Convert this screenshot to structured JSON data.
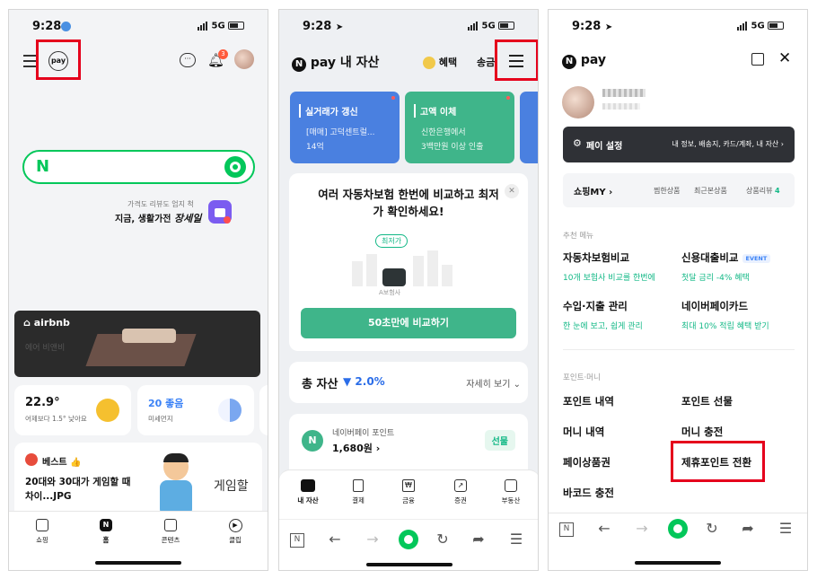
{
  "phone1": {
    "status": {
      "time": "9:28",
      "network": "5G"
    },
    "pay_logo": "pay",
    "notification_count": "3",
    "search_logo": "N",
    "promo": {
      "line1": "가격도 리뷰도 엄지 척",
      "line2": "지금, 생활가전",
      "brand": "장세일"
    },
    "banner": {
      "brand": "airbnb",
      "faded_text": "에어 비앤비"
    },
    "weather": {
      "temp": "22.9°",
      "desc": "어제보다 1.5° 낮아요"
    },
    "dust": {
      "status": "20 좋음",
      "label": "미세먼지"
    },
    "best": {
      "tag": "베스트 👍",
      "title": "20대와 30대가 게임할 때 차이...JPG",
      "side": "게임할"
    },
    "tabs": [
      {
        "label": "쇼핑"
      },
      {
        "label": "홈"
      },
      {
        "label": "콘텐츠"
      },
      {
        "label": "클립"
      }
    ]
  },
  "phone2": {
    "status": {
      "time": "9:28",
      "network": "5G"
    },
    "header": {
      "logo": "N",
      "title": "pay 내 자산",
      "benefit": "혜택",
      "cut": "송금"
    },
    "cards": [
      {
        "title": "실거래가 갱신",
        "line1": "[매매] 고덕센트럴...",
        "line2": "14억"
      },
      {
        "title": "고액 이체",
        "line1": "신한은행에서",
        "line2": "3백만원 이상 인출"
      }
    ],
    "insurance": {
      "title": "여러 자동차보험 한번에 비교하고 최저가 확인하세요!",
      "badge": "최저가",
      "caption": "A보험사",
      "cta": "50초만에 비교하기"
    },
    "assets": {
      "label": "총 자산",
      "change": "▼ 2.0%",
      "more": "자세히 보기"
    },
    "points": {
      "label": "네이버페이 포인트",
      "amount": "1,680원",
      "gift": "선물"
    },
    "tabs": [
      {
        "label": "내 자산"
      },
      {
        "label": "결제"
      },
      {
        "label": "금융"
      },
      {
        "label": "증권"
      },
      {
        "label": "부동산"
      }
    ]
  },
  "phone3": {
    "status": {
      "time": "9:28",
      "network": "5G"
    },
    "logo": "pay",
    "settings": {
      "label": "페이 설정",
      "links": "내 정보, 배송지, 카드/계좌, 내 자산"
    },
    "shopping": {
      "label": "쇼핑MY",
      "wish": "찜한상품",
      "recent": "최근본상품",
      "review": "상품리뷰",
      "review_count": "4"
    },
    "recommend_title": "추천 메뉴",
    "recommend": [
      {
        "title": "자동차보험비교",
        "sub": "10개 보험사 비교를 한번에"
      },
      {
        "title": "신용대출비교",
        "badge": "EVENT",
        "sub": "첫달 금리 -4% 혜택"
      },
      {
        "title": "수입·지출 관리",
        "sub": "한 눈에 보고, 쉽게 관리"
      },
      {
        "title": "네이버페이카드",
        "sub": "최대 10% 적립 혜택 받기"
      }
    ],
    "points_title": "포인트·머니",
    "points": [
      {
        "title": "포인트 내역"
      },
      {
        "title": "포인트 선물"
      },
      {
        "title": "머니 내역"
      },
      {
        "title": "머니 충전"
      },
      {
        "title": "페이상품권"
      },
      {
        "title": "제휴포인트 전환"
      },
      {
        "title": "바코드 충전"
      }
    ]
  },
  "colors": {
    "highlight": "#e5001c",
    "naver_green": "#03c75a",
    "pay_blue": "#3b82f6",
    "pay_teal": "#3fb58a"
  }
}
